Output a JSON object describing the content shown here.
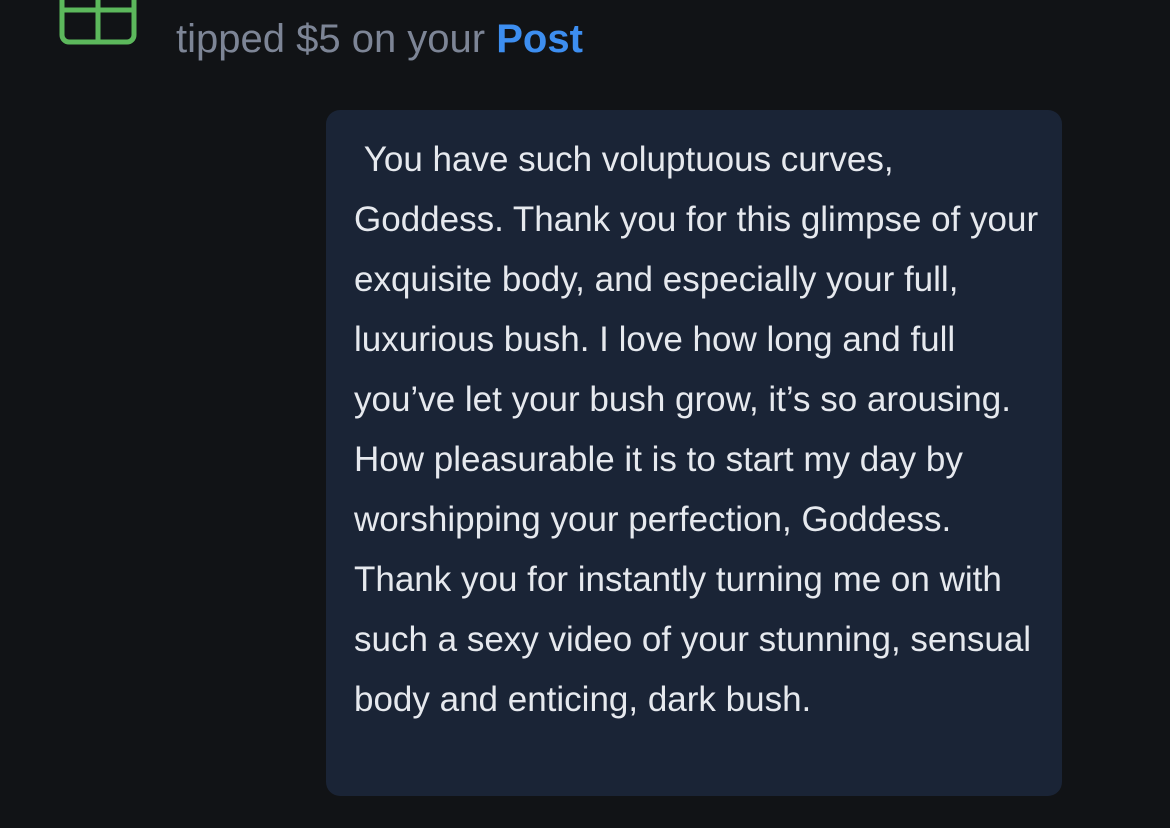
{
  "notification": {
    "icon": "gift-icon",
    "icon_color": "#5cb85c",
    "action_text": "tipped $5 on your ",
    "link_label": "Post",
    "link_color": "#3d8ef0"
  },
  "message": {
    "text": " You have such voluptuous curves, Goddess. Thank you for this glimpse of your exquisite body, and especially your full, luxurious bush. I love how long and full you’ve let your bush grow, it’s so arousing. How pleasurable it is to start my day by worshipping your perfection, Goddess. Thank you for instantly turning me on with such a sexy video of your stunning, sensual body and enticing, dark bush.",
    "bubble_color": "#1a2436"
  }
}
